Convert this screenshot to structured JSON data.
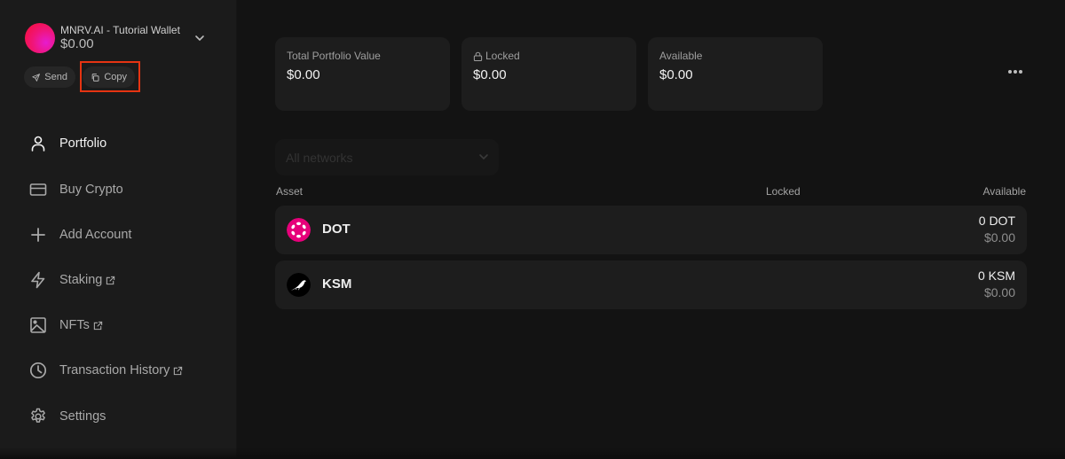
{
  "account": {
    "name": "MNRV.AI - Tutorial Wallet",
    "balance": "$0.00",
    "avatar_gradient": [
      "#f5104a",
      "#e61ccf"
    ],
    "send_label": "Send",
    "copy_label": "Copy",
    "highlight_color": "#e63412"
  },
  "sidebar": {
    "items": [
      {
        "label": "Portfolio",
        "icon": "user-icon",
        "active": true,
        "external": false
      },
      {
        "label": "Buy Crypto",
        "icon": "credit-card-icon",
        "active": false,
        "external": false
      },
      {
        "label": "Add Account",
        "icon": "plus-icon",
        "active": false,
        "external": false
      },
      {
        "label": "Staking",
        "icon": "lightning-icon",
        "active": false,
        "external": true
      },
      {
        "label": "NFTs",
        "icon": "image-icon",
        "active": false,
        "external": true
      },
      {
        "label": "Transaction History",
        "icon": "clock-icon",
        "active": false,
        "external": true
      },
      {
        "label": "Settings",
        "icon": "gear-icon",
        "active": false,
        "external": false
      }
    ]
  },
  "summary": {
    "total": {
      "label": "Total Portfolio Value",
      "value": "$0.00"
    },
    "locked": {
      "label": "Locked",
      "value": "$0.00"
    },
    "available": {
      "label": "Available",
      "value": "$0.00"
    }
  },
  "filters": {
    "network_placeholder": "All networks"
  },
  "table": {
    "headers": {
      "asset": "Asset",
      "locked": "Locked",
      "available": "Available"
    },
    "rows": [
      {
        "symbol": "DOT",
        "icon": "polkadot-icon",
        "icon_color": "#e6007a",
        "amount": "0 DOT",
        "fiat": "$0.00"
      },
      {
        "symbol": "KSM",
        "icon": "kusama-icon",
        "icon_color": "#000000",
        "amount": "0 KSM",
        "fiat": "$0.00"
      }
    ]
  }
}
